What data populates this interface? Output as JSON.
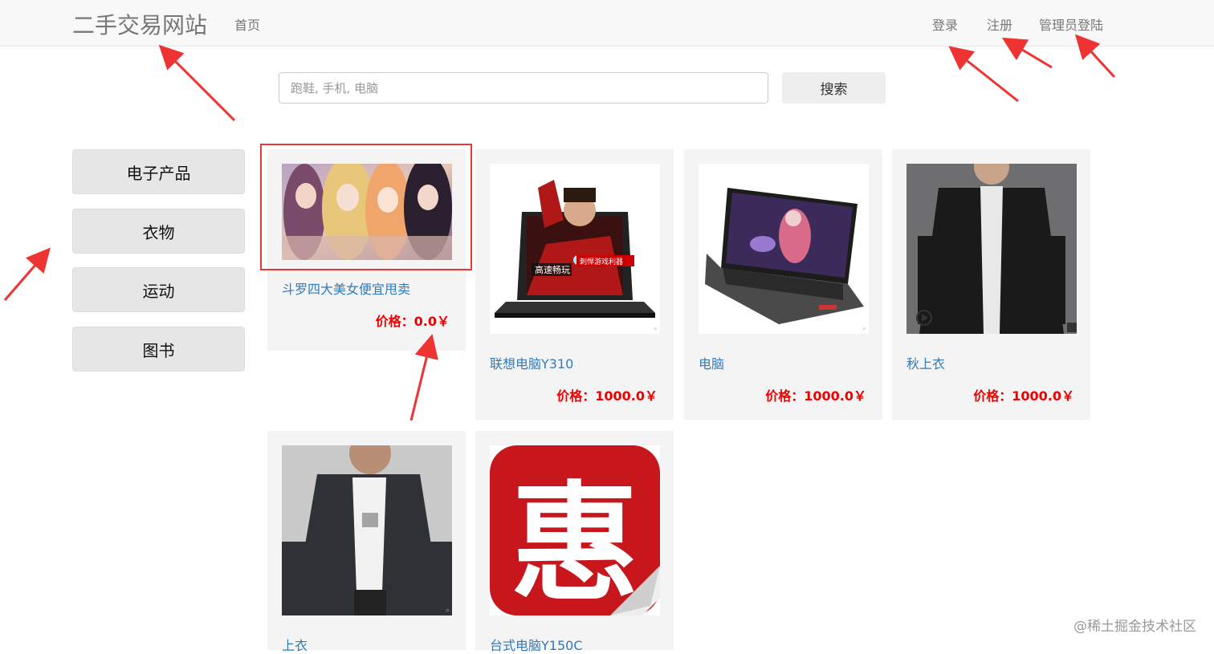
{
  "header": {
    "brand": "二手交易网站",
    "home": "首页",
    "login": "登录",
    "register": "注册",
    "admin_login": "管理员登陆"
  },
  "search": {
    "placeholder": "跑鞋, 手机, 电脑",
    "button": "搜索"
  },
  "categories": [
    "电子产品",
    "衣物",
    "运动",
    "图书"
  ],
  "products": [
    {
      "title": "斗罗四大美女便宜甩卖",
      "price": "价格：0.0￥"
    },
    {
      "title": "联想电脑Y310",
      "price": "价格：1000.0￥"
    },
    {
      "title": "电脑",
      "price": "价格：1000.0￥"
    },
    {
      "title": "秋上衣",
      "price": "价格：1000.0￥"
    },
    {
      "title": "上衣",
      "price": ""
    },
    {
      "title": "台式电脑Y150C",
      "price": ""
    }
  ],
  "laptop_banner": {
    "line1": "高速畅玩",
    "line2": "刺悍游戏利器"
  },
  "hui_char": "惠",
  "watermark": "@稀土掘金技术社区",
  "colors": {
    "price": "#e00000",
    "link": "#337ab7",
    "annotation": "#ee3333"
  }
}
